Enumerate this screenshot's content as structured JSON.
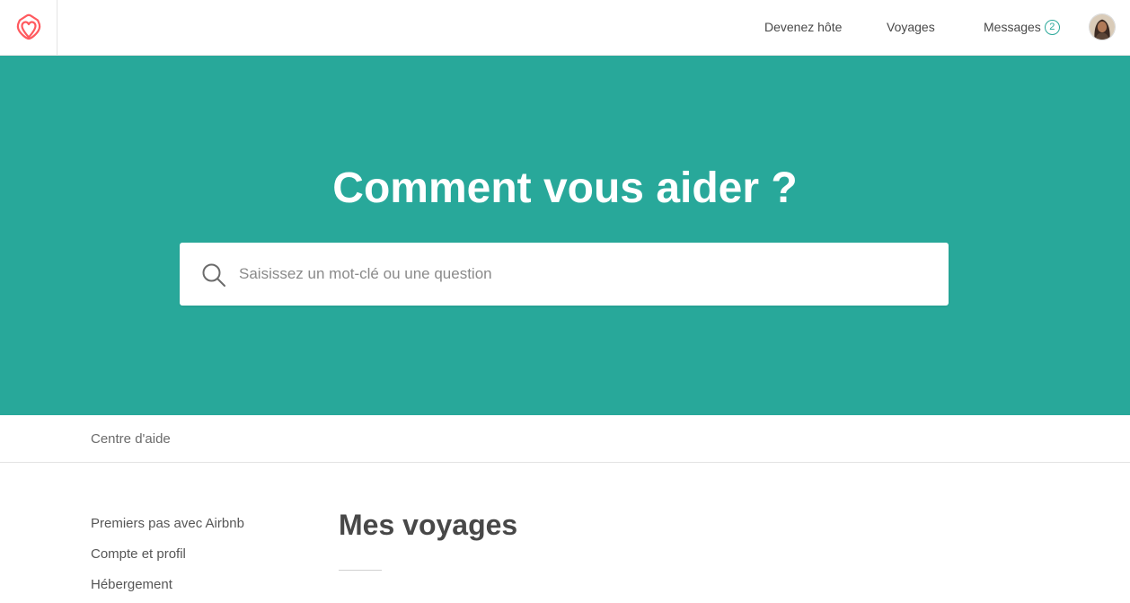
{
  "colors": {
    "brand": "#ff5a5f",
    "hero_background": "#28a89a",
    "badge_accent": "#2ba89a",
    "text": "#484848"
  },
  "topnav": {
    "logo_icon": "airbnb-logo-icon",
    "links": {
      "become_host": "Devenez hôte",
      "trips": "Voyages",
      "messages": "Messages"
    },
    "messages_count": "2",
    "avatar_icon": "user-avatar"
  },
  "hero": {
    "title": "Comment vous aider ?",
    "search": {
      "icon": "search-icon",
      "placeholder": "Saisissez un mot-clé ou une question",
      "value": ""
    }
  },
  "breadcrumb": {
    "label": "Centre d'aide"
  },
  "sidebar": {
    "items": [
      {
        "label": "Premiers pas avec Airbnb"
      },
      {
        "label": "Compte et profil"
      },
      {
        "label": "Hébergement"
      }
    ]
  },
  "main": {
    "title": "Mes voyages"
  }
}
